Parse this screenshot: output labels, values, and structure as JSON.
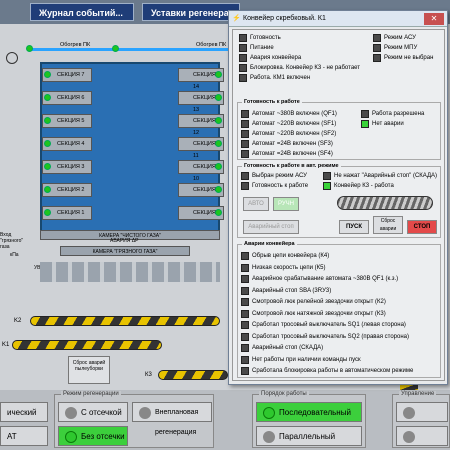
{
  "topbar": {
    "events_label": "Журнал событий...",
    "regen_label": "Уставки регенера"
  },
  "scada": {
    "heat_pk": "Обогрев ПК",
    "heat_pk2": "Обогрев ПК",
    "sections_left": [
      "СЕКЦИЯ 7",
      "СЕКЦИЯ 6",
      "СЕКЦИЯ 5",
      "СЕКЦИЯ 4",
      "СЕКЦИЯ 3",
      "СЕКЦИЯ 2",
      "СЕКЦИЯ 1"
    ],
    "sections_right": [
      "СЕКЦИЯ 14",
      "СЕКЦИЯ 13",
      "СЕКЦИЯ 12",
      "СЕКЦИЯ 11",
      "СЕКЦИЯ 10",
      "СЕКЦИЯ 9",
      "СЕКЦИЯ 8"
    ],
    "clean_gas": "КАМЕРА \"ЧИСТОГО ГАЗА\"",
    "dirty_gas": "КАМЕРА \"ГРЯЗНОГО ГАЗА\"",
    "alarm_dp": "АВАРИЯ ΔР",
    "dirty_in": "Вход \"грязного\" газа",
    "kpa": "кПа",
    "k2": "K2",
    "k1": "K1",
    "k3": "К3",
    "reset_dust": "Сброс аварий пылеуборки",
    "uvl": "УВЛ"
  },
  "bottom": {
    "mode_left_1": "ический",
    "mode_left_2": "АТ",
    "regen_title": "Режим регенерации",
    "with_cutoff": "С отсечкой",
    "without_cutoff": "Без отсечки",
    "unplanned": "Внеплановая регенерация",
    "order_title": "Порядок работы",
    "sequential": "Последовательный",
    "parallel": "Параллельный",
    "control_title": "Управление"
  },
  "dialog": {
    "title": "Конвейер скребковый. К1",
    "close": "✕",
    "status": [
      {
        "label": "Готовность",
        "on": false
      },
      {
        "label": "Питание",
        "on": false
      },
      {
        "label": "Авария конвейера",
        "on": false
      },
      {
        "label": "Блокировка. Конвейер К3 - не работает",
        "on": false
      },
      {
        "label": "Работа. КМ1 включен",
        "on": false
      }
    ],
    "modes": [
      {
        "label": "Режим АСУ",
        "on": false
      },
      {
        "label": "Режим МПУ",
        "on": false
      },
      {
        "label": "Режим не выбран",
        "on": false
      }
    ],
    "ready_title": "Готовность к работе",
    "ready": [
      {
        "label": "Автомат ~380В включен (QF1)",
        "on": false
      },
      {
        "label": "Автомат ~220В включен (SF1)",
        "on": false
      },
      {
        "label": "Автомат ~220В включен (SF2)",
        "on": false
      },
      {
        "label": "Автомат =24В включен (SF3)",
        "on": false
      },
      {
        "label": "Автомат =24В включен (SF4)",
        "on": false
      }
    ],
    "ready_right": [
      {
        "label": "Работа разрешена",
        "on": false
      },
      {
        "label": "Нет аварии",
        "on": true
      }
    ],
    "auto_title": "Готовность к работе в авт. режиме",
    "auto": [
      {
        "label": "Выбран режим АСУ",
        "on": false
      },
      {
        "label": "Готовность к работе",
        "on": false
      }
    ],
    "auto_right": [
      {
        "label": "Не нажат \"Аварийный стоп\" (СКАДА)",
        "on": false
      },
      {
        "label": "Конвейер К3 - работа",
        "on": true
      }
    ],
    "btn_auto": "АВТО",
    "btn_manual": "РУЧН",
    "btn_emergency": "Аварийный стоп",
    "btn_start": "ПУСК",
    "btn_reset": "Сброс аварии",
    "btn_stop": "СТОП",
    "alarms_title": "Аварии конвейера",
    "alarms": [
      "Обрыв цепи конвейера (К4)",
      "Низкая скорость цепи (К5)",
      "Аварийное срабатывание автомата ~380В QF1 (к.з.)",
      "Аварийный стоп SBA (3RУ3)",
      "Смотровой люк релейной звездочки открыт (К2)",
      "Смотровой люк натяжной звездочки открыт (К3)",
      "Сработал тросовый выключатель SQ1 (левая сторона)",
      "Сработал тросовый выключатель SQ2 (правая сторона)",
      "Аварийный стоп (СКАДА)",
      "Нет работы при наличии команды пуск",
      "Сработала блокировка работы в автоматическом режиме"
    ]
  }
}
